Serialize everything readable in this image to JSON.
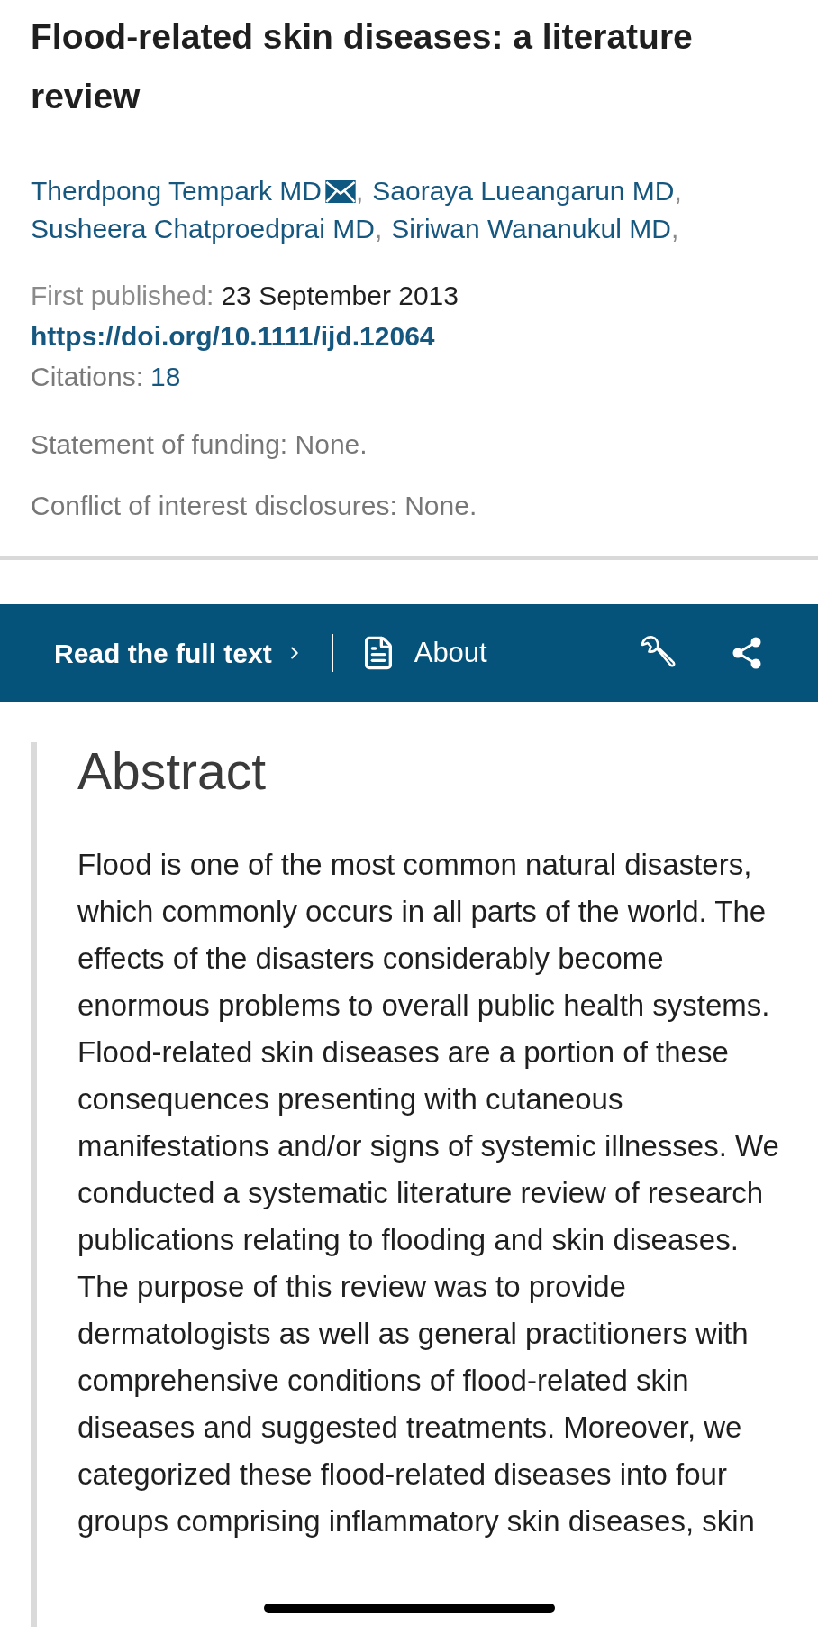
{
  "article": {
    "title": "Flood-related skin diseases: a literature review",
    "authors": [
      {
        "name": "Therdpong Tempark MD",
        "email": true,
        "separator": ","
      },
      {
        "name": "Saoraya Lueangarun MD",
        "email": false,
        "separator": ","
      },
      {
        "name": "Susheera Chatproedprai MD",
        "email": false,
        "separator": ","
      },
      {
        "name": "Siriwan Wananukul MD",
        "email": false,
        "separator": ","
      }
    ]
  },
  "meta": {
    "first_published": {
      "label": "First published:",
      "value": "23 September 2013"
    },
    "doi": "https://doi.org/10.1111/ijd.12064",
    "citations": {
      "label": "Citations:",
      "value": "18"
    },
    "notes": [
      "Statement of funding: None.",
      "Conflict of interest disclosures: None."
    ]
  },
  "toolbar": {
    "full_text": "Read the full text",
    "about": "About"
  },
  "abstract": {
    "heading": "Abstract",
    "text": "Flood is one of the most common natural disasters, which commonly occurs in all parts of the world. The effects of the disasters considerably become enormous problems to overall public health systems. Flood-related skin diseases are a portion of these consequences presenting with cutaneous manifestations and/or signs of systemic illnesses. We conducted a systematic literature review of research publications relating to flooding and skin diseases. The purpose of this review was to provide dermatologists as well as general practitioners with comprehensive conditions of flood-related skin diseases and suggested treatments. Moreover, we categorized these flood-related diseases into four groups comprising inflammatory skin diseases, skin"
  }
}
